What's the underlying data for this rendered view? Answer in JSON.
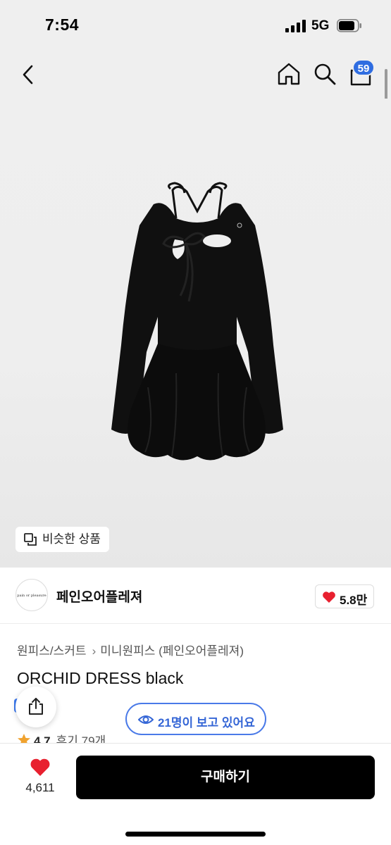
{
  "status_bar": {
    "time": "7:54",
    "network": "5G"
  },
  "nav": {
    "cart_badge": "59"
  },
  "hero": {
    "similar_products_label": "비슷한 상품"
  },
  "brand": {
    "logo_text": "pain or pleasure",
    "name": "페인오어플레져",
    "likes": "5.8만"
  },
  "product": {
    "breadcrumb": [
      "원피스/스커트",
      "미니원피스 (페인오어플레져)"
    ],
    "title": "ORCHID DRESS black",
    "rating": "4.7",
    "reviews": "후기 79개"
  },
  "viewers": {
    "label": "21명이 보고 있어요"
  },
  "bottom_bar": {
    "wish_count": "4,611",
    "buy_label": "구매하기"
  },
  "colors": {
    "accent_blue": "#2f6de1",
    "heart_red": "#e8202f",
    "buy_button": "#000000"
  }
}
